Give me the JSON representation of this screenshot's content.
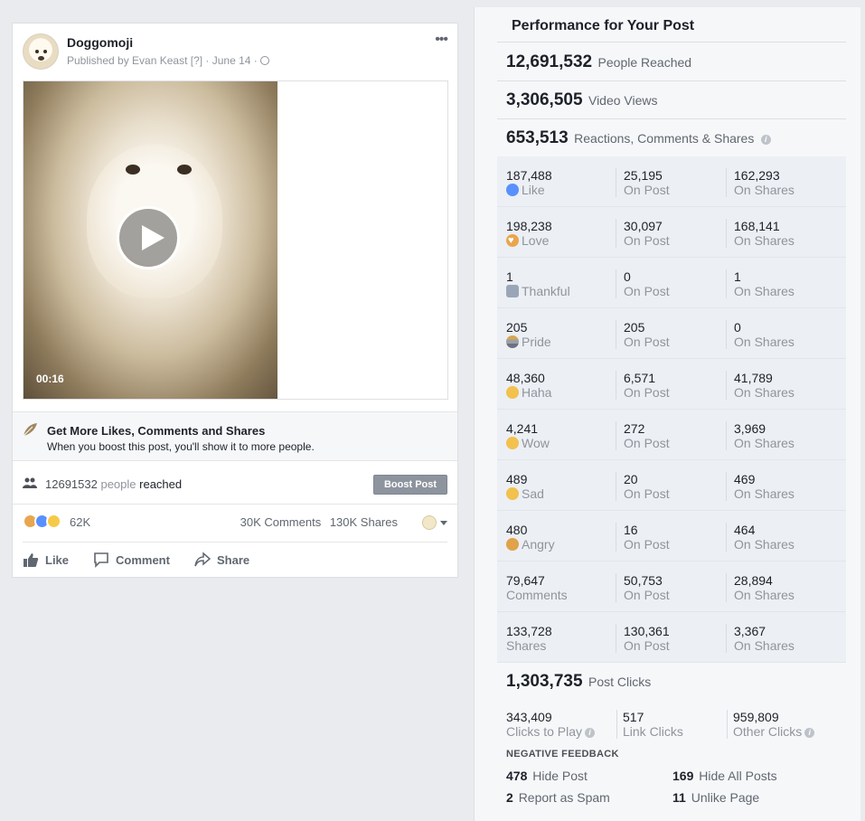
{
  "post": {
    "page_name": "Doggomoji",
    "meta": "Published by Evan Keast [?] · June 14 ·",
    "video_time": "00:16",
    "boost_title": "Get More Likes, Comments and Shares",
    "boost_sub": "When you boost this post, you'll show it to more people.",
    "reach_number": "12691532",
    "reach_people": "people",
    "reach_suffix": "reached",
    "boost_button": "Boost Post",
    "reaction_count": "62K",
    "comments": "30K Comments",
    "shares": "130K Shares",
    "actions": {
      "like": "Like",
      "comment": "Comment",
      "share": "Share"
    }
  },
  "performance": {
    "title": "Performance for Your Post",
    "people_reached": {
      "value": "12,691,532",
      "label": "People Reached"
    },
    "video_views": {
      "value": "3,306,505",
      "label": "Video Views"
    },
    "engagement": {
      "value": "653,513",
      "label": "Reactions, Comments & Shares"
    },
    "rows": [
      {
        "icon": "like",
        "total": "187,488",
        "label": "Like",
        "on_post": "25,195",
        "on_post_label": "On Post",
        "on_shares": "162,293",
        "on_shares_label": "On Shares"
      },
      {
        "icon": "love",
        "total": "198,238",
        "label": "Love",
        "on_post": "30,097",
        "on_post_label": "On Post",
        "on_shares": "168,141",
        "on_shares_label": "On Shares"
      },
      {
        "icon": "thankful",
        "total": "1",
        "label": "Thankful",
        "on_post": "0",
        "on_post_label": "On Post",
        "on_shares": "1",
        "on_shares_label": "On Shares"
      },
      {
        "icon": "pride",
        "total": "205",
        "label": "Pride",
        "on_post": "205",
        "on_post_label": "On Post",
        "on_shares": "0",
        "on_shares_label": "On Shares"
      },
      {
        "icon": "haha",
        "total": "48,360",
        "label": "Haha",
        "on_post": "6,571",
        "on_post_label": "On Post",
        "on_shares": "41,789",
        "on_shares_label": "On Shares"
      },
      {
        "icon": "wow",
        "total": "4,241",
        "label": "Wow",
        "on_post": "272",
        "on_post_label": "On Post",
        "on_shares": "3,969",
        "on_shares_label": "On Shares"
      },
      {
        "icon": "sad",
        "total": "489",
        "label": "Sad",
        "on_post": "20",
        "on_post_label": "On Post",
        "on_shares": "469",
        "on_shares_label": "On Shares"
      },
      {
        "icon": "angry",
        "total": "480",
        "label": "Angry",
        "on_post": "16",
        "on_post_label": "On Post",
        "on_shares": "464",
        "on_shares_label": "On Shares"
      },
      {
        "icon": "",
        "total": "79,647",
        "label": "Comments",
        "on_post": "50,753",
        "on_post_label": "On Post",
        "on_shares": "28,894",
        "on_shares_label": "On Shares"
      },
      {
        "icon": "",
        "total": "133,728",
        "label": "Shares",
        "on_post": "130,361",
        "on_post_label": "On Post",
        "on_shares": "3,367",
        "on_shares_label": "On Shares"
      }
    ],
    "post_clicks": {
      "value": "1,303,735",
      "label": "Post Clicks"
    },
    "clicks": [
      {
        "value": "343,409",
        "label": "Clicks to Play"
      },
      {
        "value": "517",
        "label": "Link Clicks"
      },
      {
        "value": "959,809",
        "label": "Other Clicks"
      }
    ],
    "negative_title": "NEGATIVE FEEDBACK",
    "negative": [
      {
        "value": "478",
        "label": "Hide Post"
      },
      {
        "value": "169",
        "label": "Hide All Posts"
      },
      {
        "value": "2",
        "label": "Report as Spam"
      },
      {
        "value": "11",
        "label": "Unlike Page"
      }
    ]
  }
}
